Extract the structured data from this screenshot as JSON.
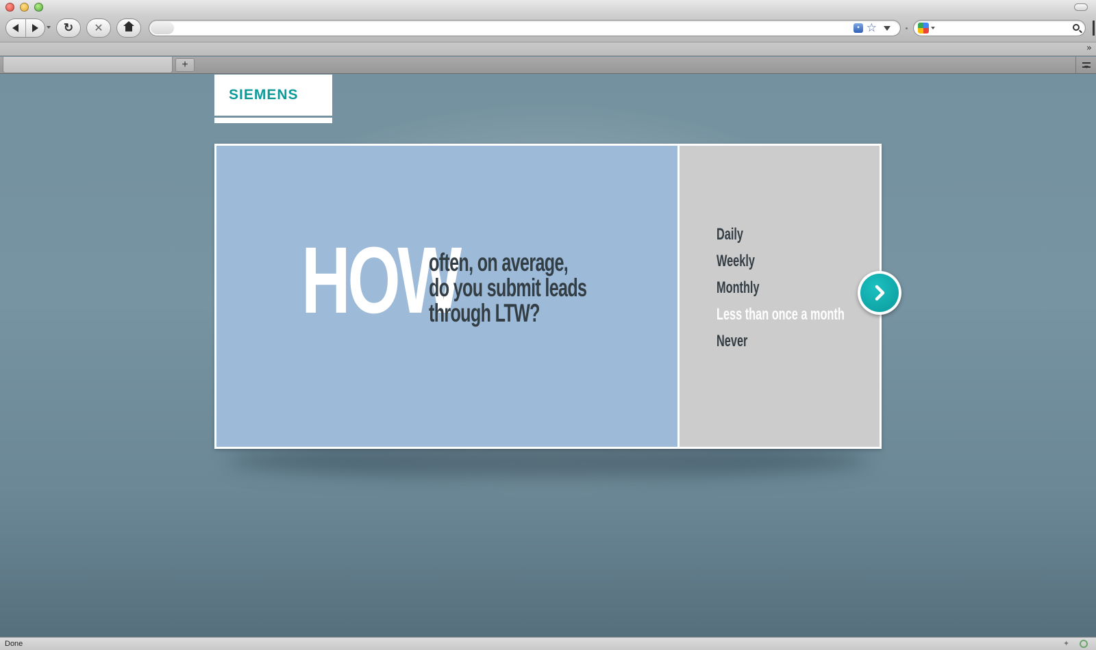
{
  "browser": {
    "url_value": "",
    "search_value": "",
    "tabs": [
      {
        "label": ""
      }
    ],
    "new_tab_label": "+",
    "overflow_label": "»",
    "status_text": "Done"
  },
  "page": {
    "logo_text": "SIEMENS",
    "question": {
      "emphasis": "HOW",
      "lines": [
        "often, on average,",
        "do you submit leads",
        "through LTW?"
      ]
    },
    "answers": [
      {
        "label": "Daily",
        "selected": false
      },
      {
        "label": "Weekly",
        "selected": false
      },
      {
        "label": "Monthly",
        "selected": false
      },
      {
        "label": "Less than once a month",
        "selected": true
      },
      {
        "label": "Never",
        "selected": false
      }
    ],
    "next_icon": "chevron-right-icon"
  },
  "colors": {
    "brand_teal": "#0f9a9a",
    "question_panel": "#9dbbd8",
    "answer_panel": "#cccccc",
    "question_text": "#333d44",
    "selected_answer": "#ffffff",
    "next_button": "#0fa9ab"
  }
}
